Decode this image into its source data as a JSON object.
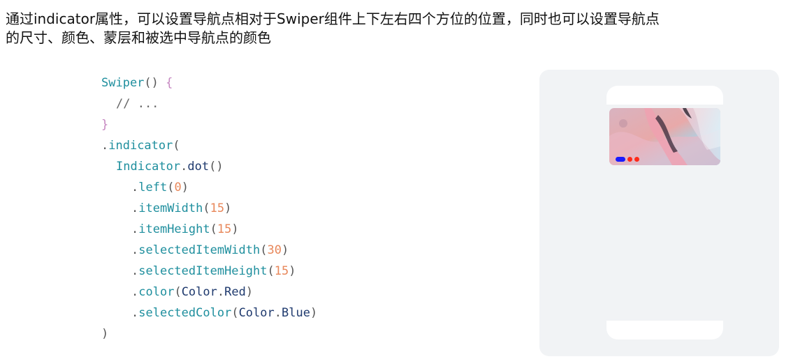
{
  "description": {
    "line1": "通过indicator属性，可以设置导航点相对于Swiper组件上下左右四个方位的位置，同时也可以设置导航点",
    "line2": "的尺寸、颜色、蒙层和被选中导航点的颜色"
  },
  "code": {
    "l1_fn": "Swiper",
    "l1_paren": "()",
    "l1_brace": " {",
    "l2_comment": "// ...",
    "l3_brace": "}",
    "l4_dot": ".",
    "l4_fn": "indicator",
    "l4_paren": "(",
    "l5_type": "Indicator",
    "l5_dot": ".",
    "l5_fn": "dot",
    "l5_paren": "()",
    "l6_dot": ".",
    "l6_fn": "left",
    "l6_open": "(",
    "l6_num": "0",
    "l6_close": ")",
    "l7_dot": ".",
    "l7_fn": "itemWidth",
    "l7_open": "(",
    "l7_num": "15",
    "l7_close": ")",
    "l8_dot": ".",
    "l8_fn": "itemHeight",
    "l8_open": "(",
    "l8_num": "15",
    "l8_close": ")",
    "l9_dot": ".",
    "l9_fn": "selectedItemWidth",
    "l9_open": "(",
    "l9_num": "30",
    "l9_close": ")",
    "l10_dot": ".",
    "l10_fn": "selectedItemHeight",
    "l10_open": "(",
    "l10_num": "15",
    "l10_close": ")",
    "l11_dot": ".",
    "l11_fn": "color",
    "l11_open": "(",
    "l11_ident": "Color",
    "l11_dot2": ".",
    "l11_ident2": "Red",
    "l11_close": ")",
    "l12_dot": ".",
    "l12_fn": "selectedColor",
    "l12_open": "(",
    "l12_ident": "Color",
    "l12_dot2": ".",
    "l12_ident2": "Blue",
    "l12_close": ")",
    "l13_paren": ")"
  },
  "preview": {
    "indicator": {
      "selected_color": "#1a1aff",
      "dot_color": "#ff2a1a",
      "dot_count": 2,
      "selected_index": 0
    }
  }
}
